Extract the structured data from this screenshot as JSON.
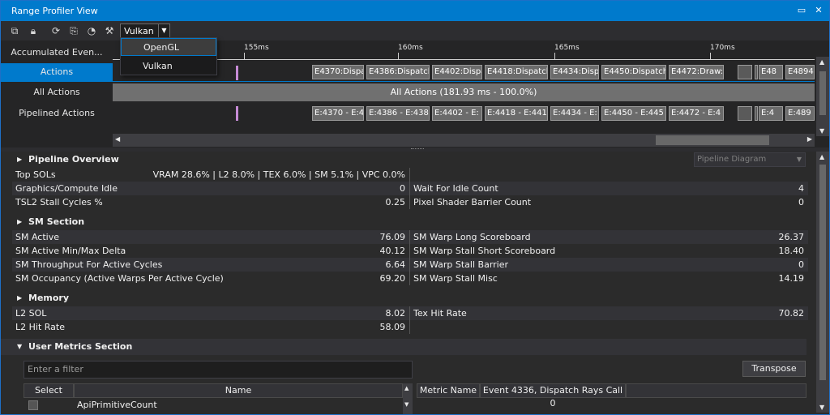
{
  "window": {
    "title": "Range Profiler View"
  },
  "toolbar": {
    "api_selected": "Vulkan"
  },
  "api_dropdown": {
    "options": [
      "OpenGL",
      "Vulkan"
    ],
    "highlighted": "OpenGL"
  },
  "timeline": {
    "ticks": [
      "155ms",
      "160ms",
      "165ms",
      "170ms"
    ],
    "rows": {
      "accumulated": "Accumulated Even...",
      "actions": "Actions",
      "all_actions": "All Actions",
      "pipelined": "Pipelined Actions"
    },
    "action_blocks": [
      "E4370:Dispa",
      "E4386:Dispatch",
      "E4402:Dispa",
      "E4418:Dispatch",
      "E4434:Disp",
      "E4450:Dispatch",
      "E4472:Draw:",
      "E48",
      "E4894"
    ],
    "all_actions_label": "All Actions (181.93 ms - 100.0%)",
    "pipelined_blocks": [
      "E:4370 - E:4",
      "E:4386 - E:438",
      "E:4402 - E:",
      "E:4418 - E:441",
      "E:4434 - E:",
      "E:4450 - E:445",
      "E:4472 - E:4",
      "E:4",
      "E:489"
    ]
  },
  "pipeline_overview": {
    "title": "Pipeline Overview",
    "diagram_select": "Pipeline Diagram",
    "top_sols_label": "Top SOLs",
    "top_sols_value": "VRAM 28.6% | L2 8.0% | TEX 6.0% | SM 5.1% | VPC 0.0%",
    "left": [
      {
        "k": "Graphics/Compute Idle",
        "v": "0"
      },
      {
        "k": "TSL2 Stall Cycles %",
        "v": "0.25"
      }
    ],
    "right": [
      {
        "k": "Wait For Idle Count",
        "v": "4"
      },
      {
        "k": "Pixel Shader Barrier Count",
        "v": "0"
      }
    ]
  },
  "sm_section": {
    "title": "SM Section",
    "left": [
      {
        "k": "SM Active",
        "v": "76.09"
      },
      {
        "k": "SM Active Min/Max Delta",
        "v": "40.12"
      },
      {
        "k": "SM Throughput For Active Cycles",
        "v": "6.64"
      },
      {
        "k": "SM Occupancy (Active Warps Per Active Cycle)",
        "v": "69.20"
      }
    ],
    "right": [
      {
        "k": "SM Warp Long Scoreboard",
        "v": "26.37"
      },
      {
        "k": "SM Warp Stall Short Scoreboard",
        "v": "18.40"
      },
      {
        "k": "SM Warp Stall Barrier",
        "v": "0"
      },
      {
        "k": "SM Warp Stall Misc",
        "v": "14.19"
      }
    ]
  },
  "memory": {
    "title": "Memory",
    "left": [
      {
        "k": "L2 SOL",
        "v": "8.02"
      },
      {
        "k": "L2 Hit Rate",
        "v": "58.09"
      }
    ],
    "right": [
      {
        "k": "Tex Hit Rate",
        "v": "70.82"
      }
    ]
  },
  "user_metrics": {
    "title": "User Metrics Section",
    "filter_placeholder": "Enter a filter",
    "transpose": "Transpose",
    "col_select": "Select",
    "col_name": "Name",
    "col_metric_name": "Metric Name",
    "col_event": "Event 4336, Dispatch Rays Call 0",
    "first_row_name": "ApiPrimitiveCount"
  }
}
